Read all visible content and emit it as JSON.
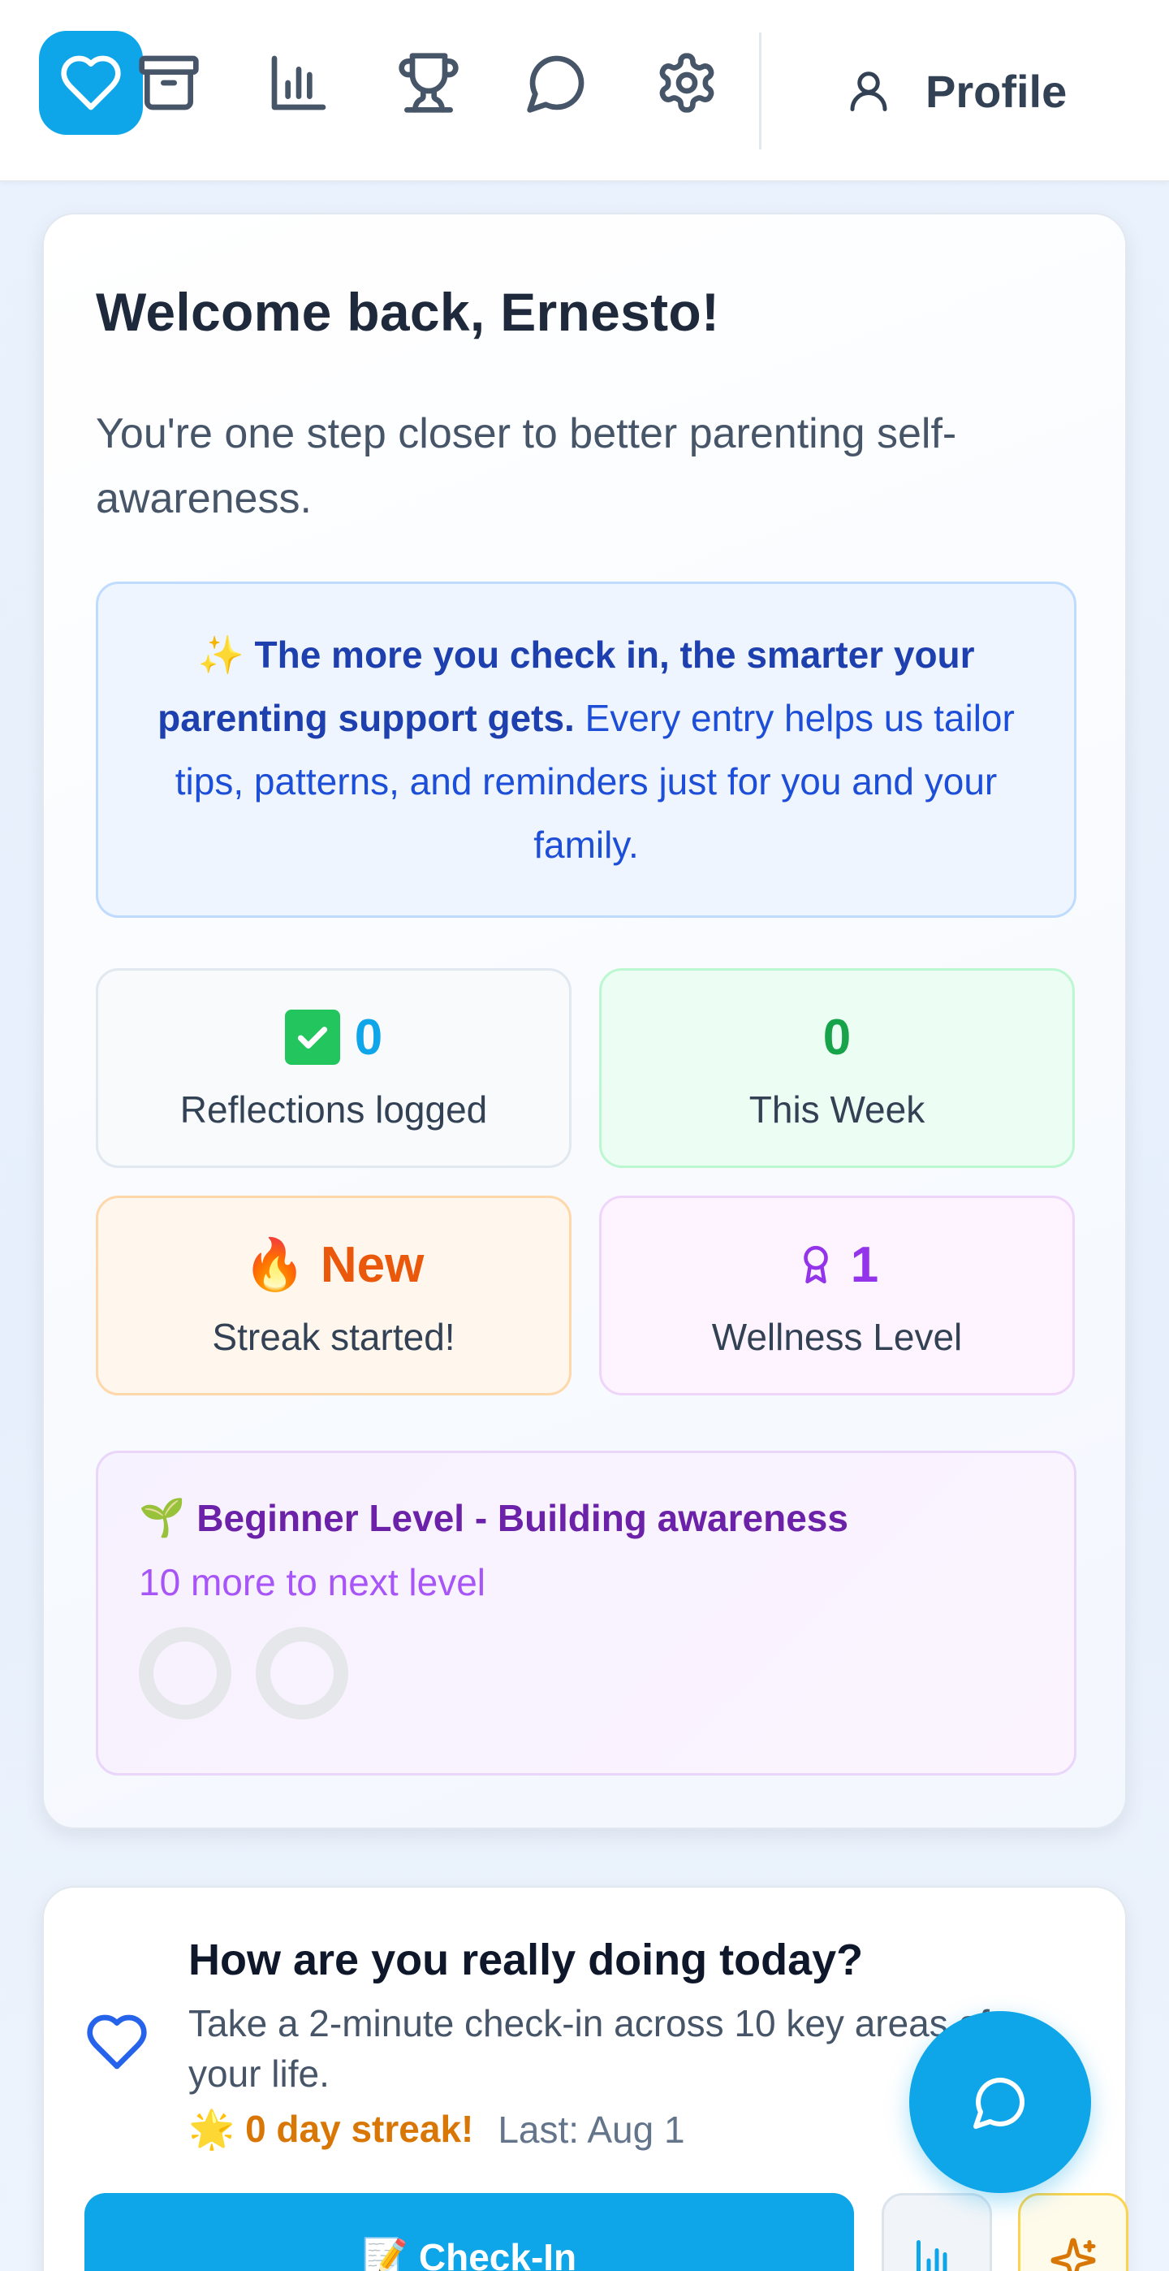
{
  "nav": {
    "items": [
      {
        "icon": "heart-icon",
        "active": true
      },
      {
        "icon": "archive-icon",
        "active": false
      },
      {
        "icon": "bar-chart-icon",
        "active": false
      },
      {
        "icon": "trophy-icon",
        "active": false
      },
      {
        "icon": "message-circle-icon",
        "active": false
      },
      {
        "icon": "gear-icon",
        "active": false
      }
    ],
    "profile_icon": "user-icon",
    "profile_label": "Profile",
    "accent": "#0ea5e9"
  },
  "welcome": {
    "title": "Welcome back, Ernesto!",
    "subtitle": "You're one step closer to better parenting self-awareness.",
    "tip_emoji": "✨",
    "tip_bold": "The more you check in, the smarter your parenting support gets.",
    "tip_text": "Every entry helps us tailor tips, patterns, and reminders just for you and your family."
  },
  "stats": [
    {
      "icon": "check-box-emoji",
      "value": "0",
      "label": "Reflections logged"
    },
    {
      "icon": "",
      "value": "0",
      "label": "This Week"
    },
    {
      "icon": "fire-emoji",
      "emoji": "🔥",
      "value": "New",
      "label": "Streak started!"
    },
    {
      "icon": "award-icon",
      "value": "1",
      "label": "Wellness Level"
    }
  ],
  "level": {
    "emoji": "🌱",
    "title": "Beginner Level - Building awareness",
    "next": "10 more to next level",
    "progress_rings": 2
  },
  "checkin": {
    "title": "How are you really doing today?",
    "description": "Take a 2-minute check-in across 10 key areas of your life.",
    "streak_emoji": "🌟",
    "streak": "0 day streak!",
    "last": "Last: Aug 1",
    "button_label": "📝 Check-In"
  }
}
